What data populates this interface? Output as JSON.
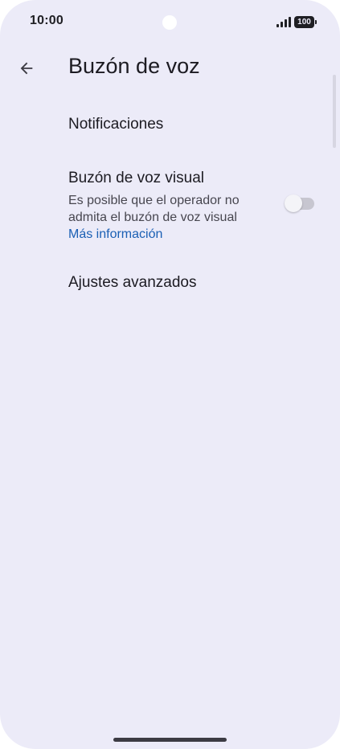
{
  "status_bar": {
    "time": "10:00",
    "battery": "100",
    "signal_icon": "signal-icon",
    "battery_icon": "battery-icon"
  },
  "app_bar": {
    "back_icon": "arrow-back-icon",
    "title": "Buzón de voz"
  },
  "settings": {
    "notifications": {
      "title": "Notificaciones"
    },
    "visual_voicemail": {
      "title": "Buzón de voz visual",
      "summary": "Es posible que el operador no admita el buzón de voz visual",
      "link": "Más información",
      "enabled": false
    },
    "advanced": {
      "title": "Ajustes avanzados"
    }
  },
  "colors": {
    "background": "#ecebf8",
    "text_primary": "#1c1b22",
    "text_secondary": "#47464f",
    "link": "#1a5fb4"
  }
}
